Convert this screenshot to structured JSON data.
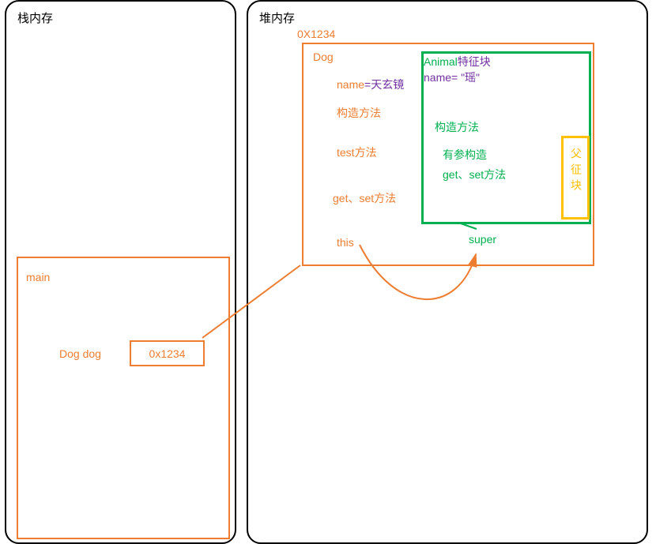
{
  "stack": {
    "title": "栈内存",
    "main_frame": {
      "label": "main",
      "var_decl": "Dog   dog",
      "var_addr": "0x1234"
    }
  },
  "heap": {
    "title": "堆内存",
    "address": "0X1234",
    "dog_object": {
      "class_name": "Dog",
      "name_field_key": "name",
      "name_field_eq": "=",
      "name_field_val": "天玄镜",
      "constructor": "构造方法",
      "test_method": "test方法",
      "getset": "get、set方法",
      "this_label": "this",
      "super_label": "super"
    },
    "animal_block": {
      "title_part1": "Animal",
      "title_part2": "特征块",
      "name_line": "name= \"瑶\"",
      "constructor": "构造方法",
      "arg_constructor": "有参构造",
      "getset": "get、set方法"
    },
    "parent_block": {
      "text": "父征块"
    }
  },
  "colors": {
    "orange": "#ed7d31",
    "green": "#00b050",
    "yellow": "#ffc000",
    "purple": "#7030a0"
  }
}
